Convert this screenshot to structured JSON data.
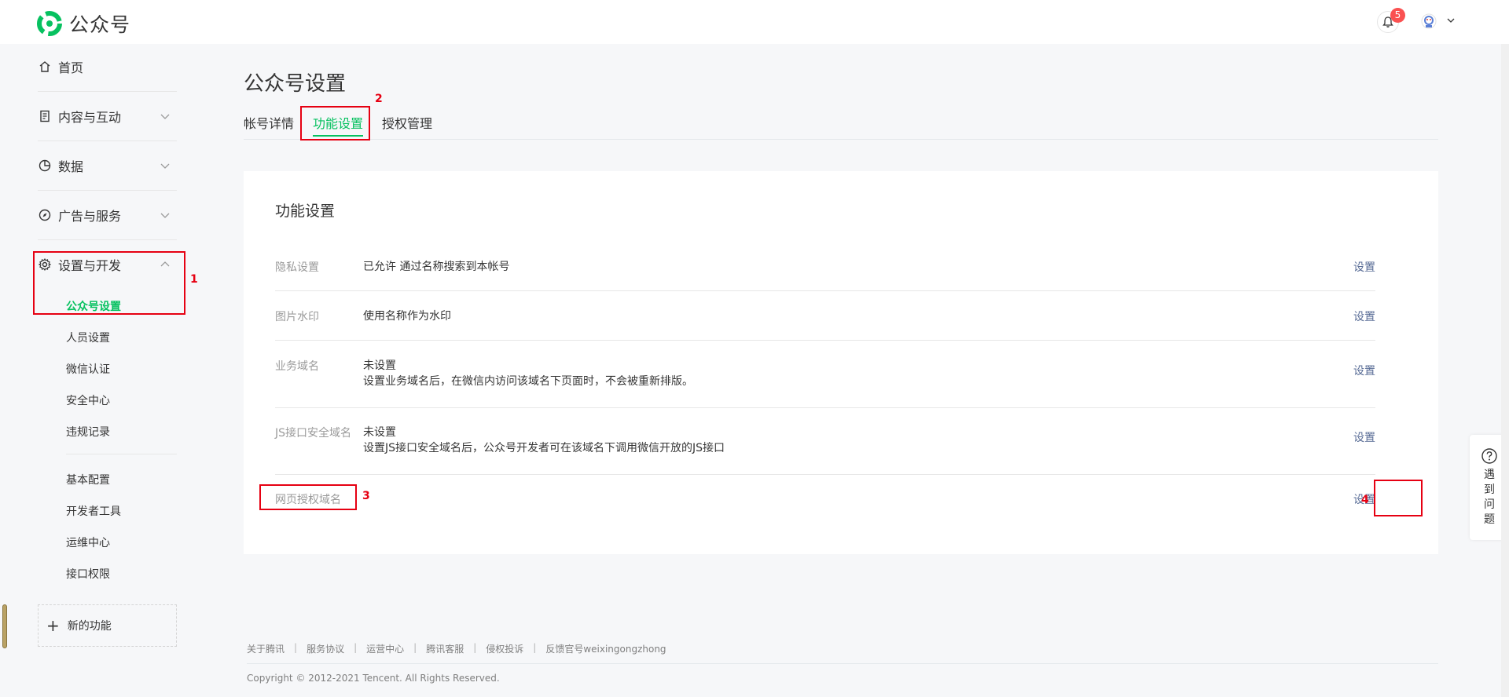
{
  "topbar": {
    "brand": "公众号",
    "notification_count": "5",
    "brand_color": "#07c160"
  },
  "sidebar": {
    "items": [
      {
        "label": "首页",
        "icon": "home-icon"
      },
      {
        "label": "内容与互动",
        "icon": "document-icon"
      },
      {
        "label": "数据",
        "icon": "pie-chart-icon"
      },
      {
        "label": "广告与服务",
        "icon": "compass-icon"
      },
      {
        "label": "设置与开发",
        "icon": "gear-icon"
      }
    ],
    "settings_sub": [
      "公众号设置",
      "人员设置",
      "微信认证",
      "安全中心",
      "违规记录"
    ],
    "dev_sub": [
      "基本配置",
      "开发者工具",
      "运维中心",
      "接口权限"
    ],
    "new_feature": "新的功能"
  },
  "main": {
    "title": "公众号设置",
    "tabs": [
      "帐号详情",
      "功能设置",
      "授权管理"
    ],
    "card_title": "功能设置",
    "rows": [
      {
        "label": "隐私设置",
        "value_line1": "已允许 通过名称搜索到本帐号",
        "value_line2": "",
        "action": "设置"
      },
      {
        "label": "图片水印",
        "value_line1": "使用名称作为水印",
        "value_line2": "",
        "action": "设置"
      },
      {
        "label": "业务域名",
        "value_line1": "未设置",
        "value_line2": "设置业务域名后，在微信内访问该域名下页面时，不会被重新排版。",
        "action": "设置"
      },
      {
        "label": "JS接口安全域名",
        "value_line1": "未设置",
        "value_line2": "设置JS接口安全域名后，公众号开发者可在该域名下调用微信开放的JS接口",
        "action": "设置"
      },
      {
        "label": "网页授权域名",
        "value_line1": "",
        "value_line2": "",
        "action": "设置"
      }
    ]
  },
  "footer": {
    "links": [
      "关于腾讯",
      "服务协议",
      "运营中心",
      "腾讯客服",
      "侵权投诉",
      "反馈官号weixingongzhong"
    ],
    "separator": "|",
    "copyright": "Copyright © 2012-2021 Tencent. All Rights Reserved."
  },
  "help": {
    "label": "遇到问题"
  },
  "annotations": [
    "1",
    "2",
    "3",
    "4"
  ]
}
